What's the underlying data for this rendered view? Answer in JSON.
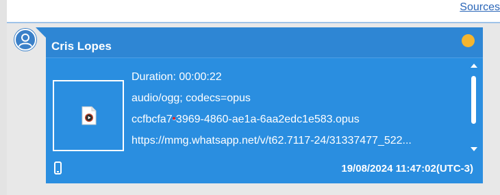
{
  "top_bar": {
    "sources_link": "Sources"
  },
  "message": {
    "sender": "Cris Lopes",
    "status_color": "#f5b52e",
    "attachment_icon": "audio-file-icon",
    "duration": "Duration: 00:00:22",
    "mime_type": "audio/ogg; codecs=opus",
    "filename": "ccfbcfa7-3969-4860-ae1a-6aa2edc1e583.opus",
    "url": "https://mmg.whatsapp.net/v/t62.7117-24/31337477_522...",
    "device_icon": "mobile-device-icon",
    "timestamp": "19/08/2024 11:47:02(UTC-3)"
  },
  "colors": {
    "bubble": "#2e86d4",
    "bubble_body": "#2a8ee0",
    "link": "#2a66b8"
  }
}
